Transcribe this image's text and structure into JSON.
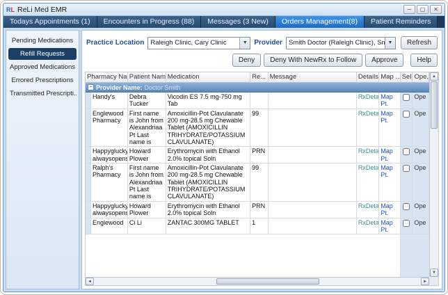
{
  "window": {
    "title": "ReLi Med EMR",
    "logo_r": "R",
    "logo_l": "L",
    "minimize": "─",
    "maximize": "▢",
    "close": "✕"
  },
  "tabs": [
    {
      "label": "Todays Appointments (1)"
    },
    {
      "label": "Encounters in Progress (88)"
    },
    {
      "label": "Messages (3 New)"
    },
    {
      "label": "Orders Management(8)"
    },
    {
      "label": "Patient Reminders"
    }
  ],
  "sidebar": {
    "items": [
      {
        "label": "Pending Medications"
      },
      {
        "label": "Refill Requests"
      },
      {
        "label": "Approved Medications"
      },
      {
        "label": "Errored Prescriptions"
      },
      {
        "label": "Transmitted Prescripti..."
      }
    ]
  },
  "filters": {
    "practice_location_label": "Practice Location",
    "practice_location_value": "Raleigh Clinic, Cary Clinic",
    "provider_label": "Provider",
    "provider_value": "Smith Doctor (Raleigh Clinic), Smith Do...",
    "refresh_label": "Refresh",
    "dropdown_arrow": "▼"
  },
  "actions": {
    "deny": "Deny",
    "deny_with_newrx": "Deny With NewRx to Follow",
    "approve": "Approve",
    "help": "Help"
  },
  "table": {
    "columns": [
      "Pharmacy Name",
      "Patient Name",
      "Medication",
      "Re...",
      "Message",
      "Details",
      "Map ...",
      "Sel",
      "Ope..."
    ],
    "group": {
      "collapse": "−",
      "label": "Provider Name:",
      "value": "Doctor Smith"
    },
    "rows": [
      {
        "pharmacy": "Handy's",
        "patient": "Debra Tucker",
        "medication": "Vicodin ES 7.5 mg-750 mg Tab",
        "refills": "",
        "message": "",
        "details": "RxDetails",
        "map": "Map Pt.",
        "open": "Ope"
      },
      {
        "pharmacy": "Englewood Pharmacy",
        "patient": "First name is John from Alexandriaa Pt Last name is",
        "medication": "Amoxicillin-Pot Clavulanate 200 mg-28.5 mg Chewable Tablet (AMOXICILLIN TRIHYDRATE/POTASSIUM CLAVULANATE)",
        "refills": "99",
        "message": "",
        "details": "RxDetails",
        "map": "Map Pt.",
        "open": "Ope"
      },
      {
        "pharmacy": "Happyglucky alwaysopens",
        "patient": "Howard Plower",
        "medication": "Erythromycin with Ethanol 2.0% topical Soln",
        "refills": "PRN",
        "message": "",
        "details": "RxDetails",
        "map": "Map Pt.",
        "open": "Ope"
      },
      {
        "pharmacy": "Ralph's Pharmacy",
        "patient": "First name is John from Alexandriaa Pt Last name is",
        "medication": "Amoxicillin-Pot Clavulanate 200 mg-28.5 mg Chewable Tablet (AMOXICILLIN TRIHYDRATE/POTASSIUM CLAVULANATE)",
        "refills": "99",
        "message": "",
        "details": "RxDetails",
        "map": "Map Pt.",
        "open": "Ope"
      },
      {
        "pharmacy": "Happyglucky alwaysopens",
        "patient": "Howard Plower",
        "medication": "Erythromycin with Ethanol 2.0% topical Soln",
        "refills": "PRN",
        "message": "",
        "details": "RxDetails",
        "map": "Map Pt.",
        "open": "Ope"
      },
      {
        "pharmacy": "Englewood",
        "patient": "Ci Li",
        "medication": "ZANTAC 300MG TABLET",
        "refills": "1",
        "message": "",
        "details": "RxDetails",
        "map": "Map Pt.",
        "open": "Ope"
      }
    ]
  },
  "scrollbar": {
    "up": "▲",
    "down": "▼",
    "left": "◄",
    "right": "►"
  }
}
